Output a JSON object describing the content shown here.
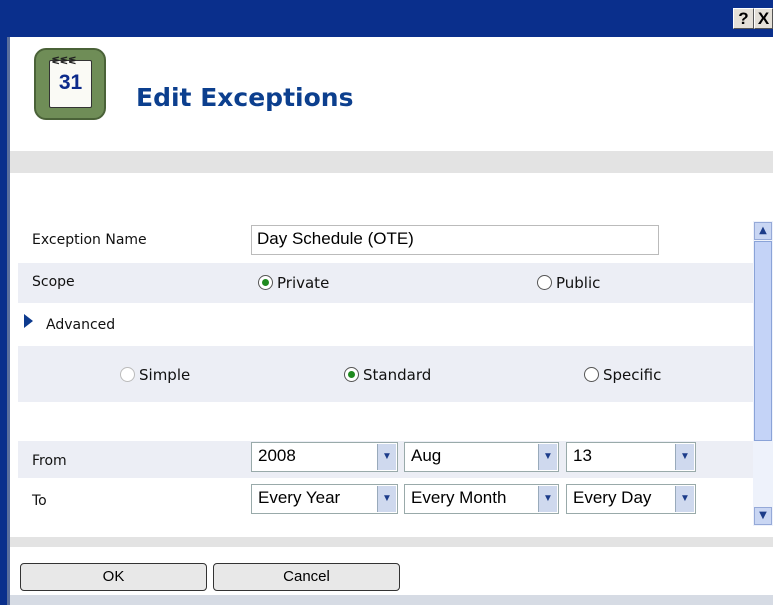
{
  "window": {
    "help_label": "?",
    "close_label": "X"
  },
  "header": {
    "icon_number": "31",
    "icon_rings": "ᓬᓬᓬ",
    "title": "Edit Exceptions"
  },
  "form": {
    "exception_name": {
      "label": "Exception Name",
      "value": "Day Schedule (OTE)"
    },
    "scope": {
      "label": "Scope",
      "options": [
        {
          "label": "Private",
          "selected": true
        },
        {
          "label": "Public",
          "selected": false
        }
      ]
    },
    "advanced": {
      "label": "Advanced"
    },
    "mode": {
      "options": [
        {
          "label": "Simple",
          "selected": false,
          "disabled": true
        },
        {
          "label": "Standard",
          "selected": true
        },
        {
          "label": "Specific",
          "selected": false
        }
      ]
    },
    "from": {
      "label": "From",
      "year": "2008",
      "month": "Aug",
      "day": "13"
    },
    "to": {
      "label": "To",
      "year": "Every Year",
      "month": "Every Month",
      "day": "Every Day"
    }
  },
  "buttons": {
    "ok": "OK",
    "cancel": "Cancel"
  },
  "colors": {
    "titlebar": "#0a2f8c",
    "title_text": "#0c3f8e",
    "row_shade": "#eceef5"
  }
}
